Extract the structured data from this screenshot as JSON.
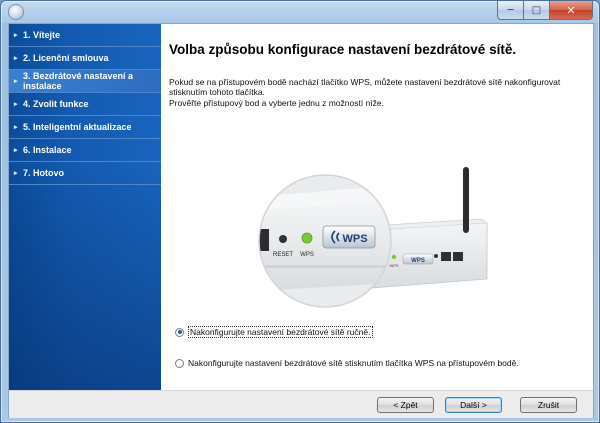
{
  "window": {
    "minimize_glyph": "─",
    "maximize_glyph": "□",
    "close_glyph": "✕"
  },
  "sidebar": {
    "items": [
      {
        "label": "1. Vítejte"
      },
      {
        "label": "2. Licenční smlouva"
      },
      {
        "label": "3. Bezdrátové nastavení a instalace"
      },
      {
        "label": "4. Zvolit funkce"
      },
      {
        "label": "5. Inteligentní aktualizace"
      },
      {
        "label": "6. Instalace"
      },
      {
        "label": "7. Hotovo"
      }
    ],
    "active_index": 2,
    "arrow_glyph": "▸"
  },
  "main": {
    "title": "Volba způsobu konfigurace nastavení bezdrátové sítě.",
    "description_line1": "Pokud se na přístupovém bodě nachází tlačítko WPS, můžete nastavení bezdrátové sítě nakonfigurovat stisknutím tohoto tlačítka.",
    "description_line2": "Prověřte přístupový bod a vyberte jednu z možností níže.",
    "illustration": {
      "reset_label": "RESET",
      "wps_led_label": "WPS",
      "wps_button_label": "WPS",
      "router_wps_led_label": "WPS"
    },
    "options": [
      {
        "label": "Nakonfigurujte nastavení bezdrátové sítě ručně.",
        "selected": true
      },
      {
        "label": "Nakonfigurujte nastavení bezdrátové sítě stisknutím tlačítka WPS na přístupovém bodě.",
        "selected": false
      }
    ]
  },
  "footer": {
    "back_label": "< Zpět",
    "next_label": "Další >",
    "cancel_label": "Zrušit"
  },
  "colors": {
    "sidebar_blue": "#1458ad",
    "led_green": "#7cc83a",
    "window_frame": "#a9c7e6"
  }
}
